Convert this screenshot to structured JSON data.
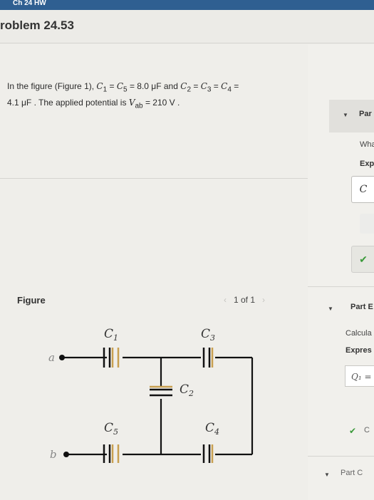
{
  "header": {
    "course": "Ch 24 HW"
  },
  "problem": {
    "title": "roblem 24.53",
    "text_1": "In the figure (",
    "figure_link": "Figure 1",
    "text_2": "), ",
    "c1": "C",
    "c1_sub": "1",
    "eq1": " = ",
    "c5": "C",
    "c5_sub": "5",
    "val1": " = 8.0 μF",
    "and": " and ",
    "c2": "C",
    "c2_sub": "2",
    "eq2": " = ",
    "c3": "C",
    "c3_sub": "3",
    "eq3": " = ",
    "c4": "C",
    "c4_sub": "4",
    "eq4": " =",
    "val2": "4.1 μF",
    "text_3": " . The applied potential is ",
    "vab": "V",
    "vab_sub": "ab",
    "val3": " = 210 V",
    "end": " ."
  },
  "figure": {
    "label": "Figure",
    "pager": "1 of 1",
    "prev": "‹",
    "next": "›",
    "labels": {
      "c1": "C",
      "c1_sub": "1",
      "c3": "C",
      "c3_sub": "3",
      "c2": "C",
      "c2_sub": "2",
      "c5": "C",
      "c5_sub": "5",
      "c4": "C",
      "c4_sub": "4",
      "a": "a",
      "b": "b"
    }
  },
  "right_panel": {
    "part_a_label": "Par",
    "question": "Wha",
    "express": "Expr",
    "input_value": "C",
    "check_a": "✔",
    "part_b_label": "Part E",
    "calc": "Calcula",
    "express_b": "Expres",
    "q1_value": "Q₁ =",
    "check_b": "✔",
    "check_b_text": "C",
    "part_c_label": "Part C"
  },
  "colors": {
    "accent_blue": "#2f5f91",
    "check_green": "#3a9a3a",
    "capacitor_plate": "#c8a050"
  }
}
